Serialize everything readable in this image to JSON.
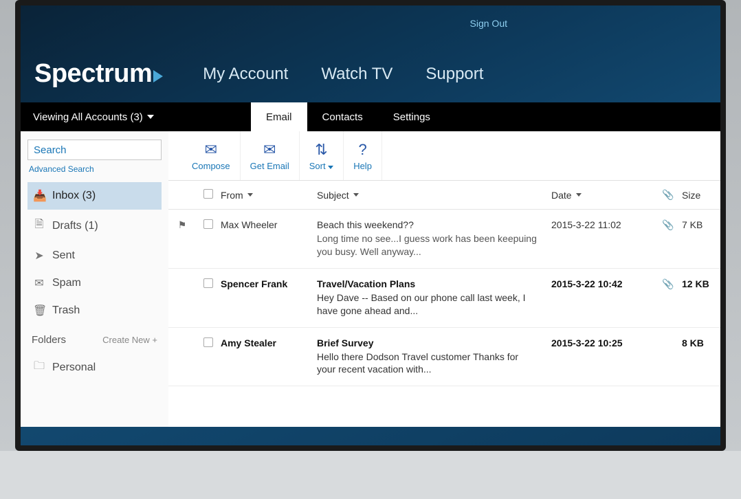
{
  "top": {
    "sign_out": "Sign Out"
  },
  "brand": {
    "name": "Spectrum"
  },
  "nav": {
    "my_account": "My Account",
    "watch_tv": "Watch TV",
    "support": "Support"
  },
  "subbar": {
    "accounts": "Viewing All Accounts (3)",
    "tabs": {
      "email": "Email",
      "contacts": "Contacts",
      "settings": "Settings"
    }
  },
  "sidebar": {
    "search_placeholder": "Search",
    "advanced": "Advanced Search",
    "folders": {
      "inbox": "Inbox (3)",
      "drafts": "Drafts (1)",
      "sent": "Sent",
      "spam": "Spam",
      "trash": "Trash"
    },
    "folders_label": "Folders",
    "create_new": "Create New +",
    "custom": {
      "personal": "Personal"
    }
  },
  "toolbar": {
    "compose": "Compose",
    "get_email": "Get Email",
    "sort": "Sort",
    "help": "Help"
  },
  "columns": {
    "from": "From",
    "subject": "Subject",
    "date": "Date",
    "size": "Size"
  },
  "messages": [
    {
      "from": "Max Wheeler",
      "subject": "Beach this weekend??",
      "preview": "Long time no see...I guess work has been keepuing you busy. Well anyway...",
      "date": "2015-3-22 11:02",
      "size": "7 KB",
      "unread": false,
      "flagged": true,
      "attachment": true
    },
    {
      "from": "Spencer Frank",
      "subject": "Travel/Vacation Plans",
      "preview": "Hey Dave -- Based on our phone call last week, I have gone ahead and...",
      "date": "2015-3-22 10:42",
      "size": "12 KB",
      "unread": true,
      "flagged": false,
      "attachment": true
    },
    {
      "from": "Amy Stealer",
      "subject": "Brief Survey",
      "preview": "Hello there Dodson Travel customer Thanks for your recent vacation with...",
      "date": "2015-3-22 10:25",
      "size": "8 KB",
      "unread": true,
      "flagged": false,
      "attachment": false
    }
  ]
}
